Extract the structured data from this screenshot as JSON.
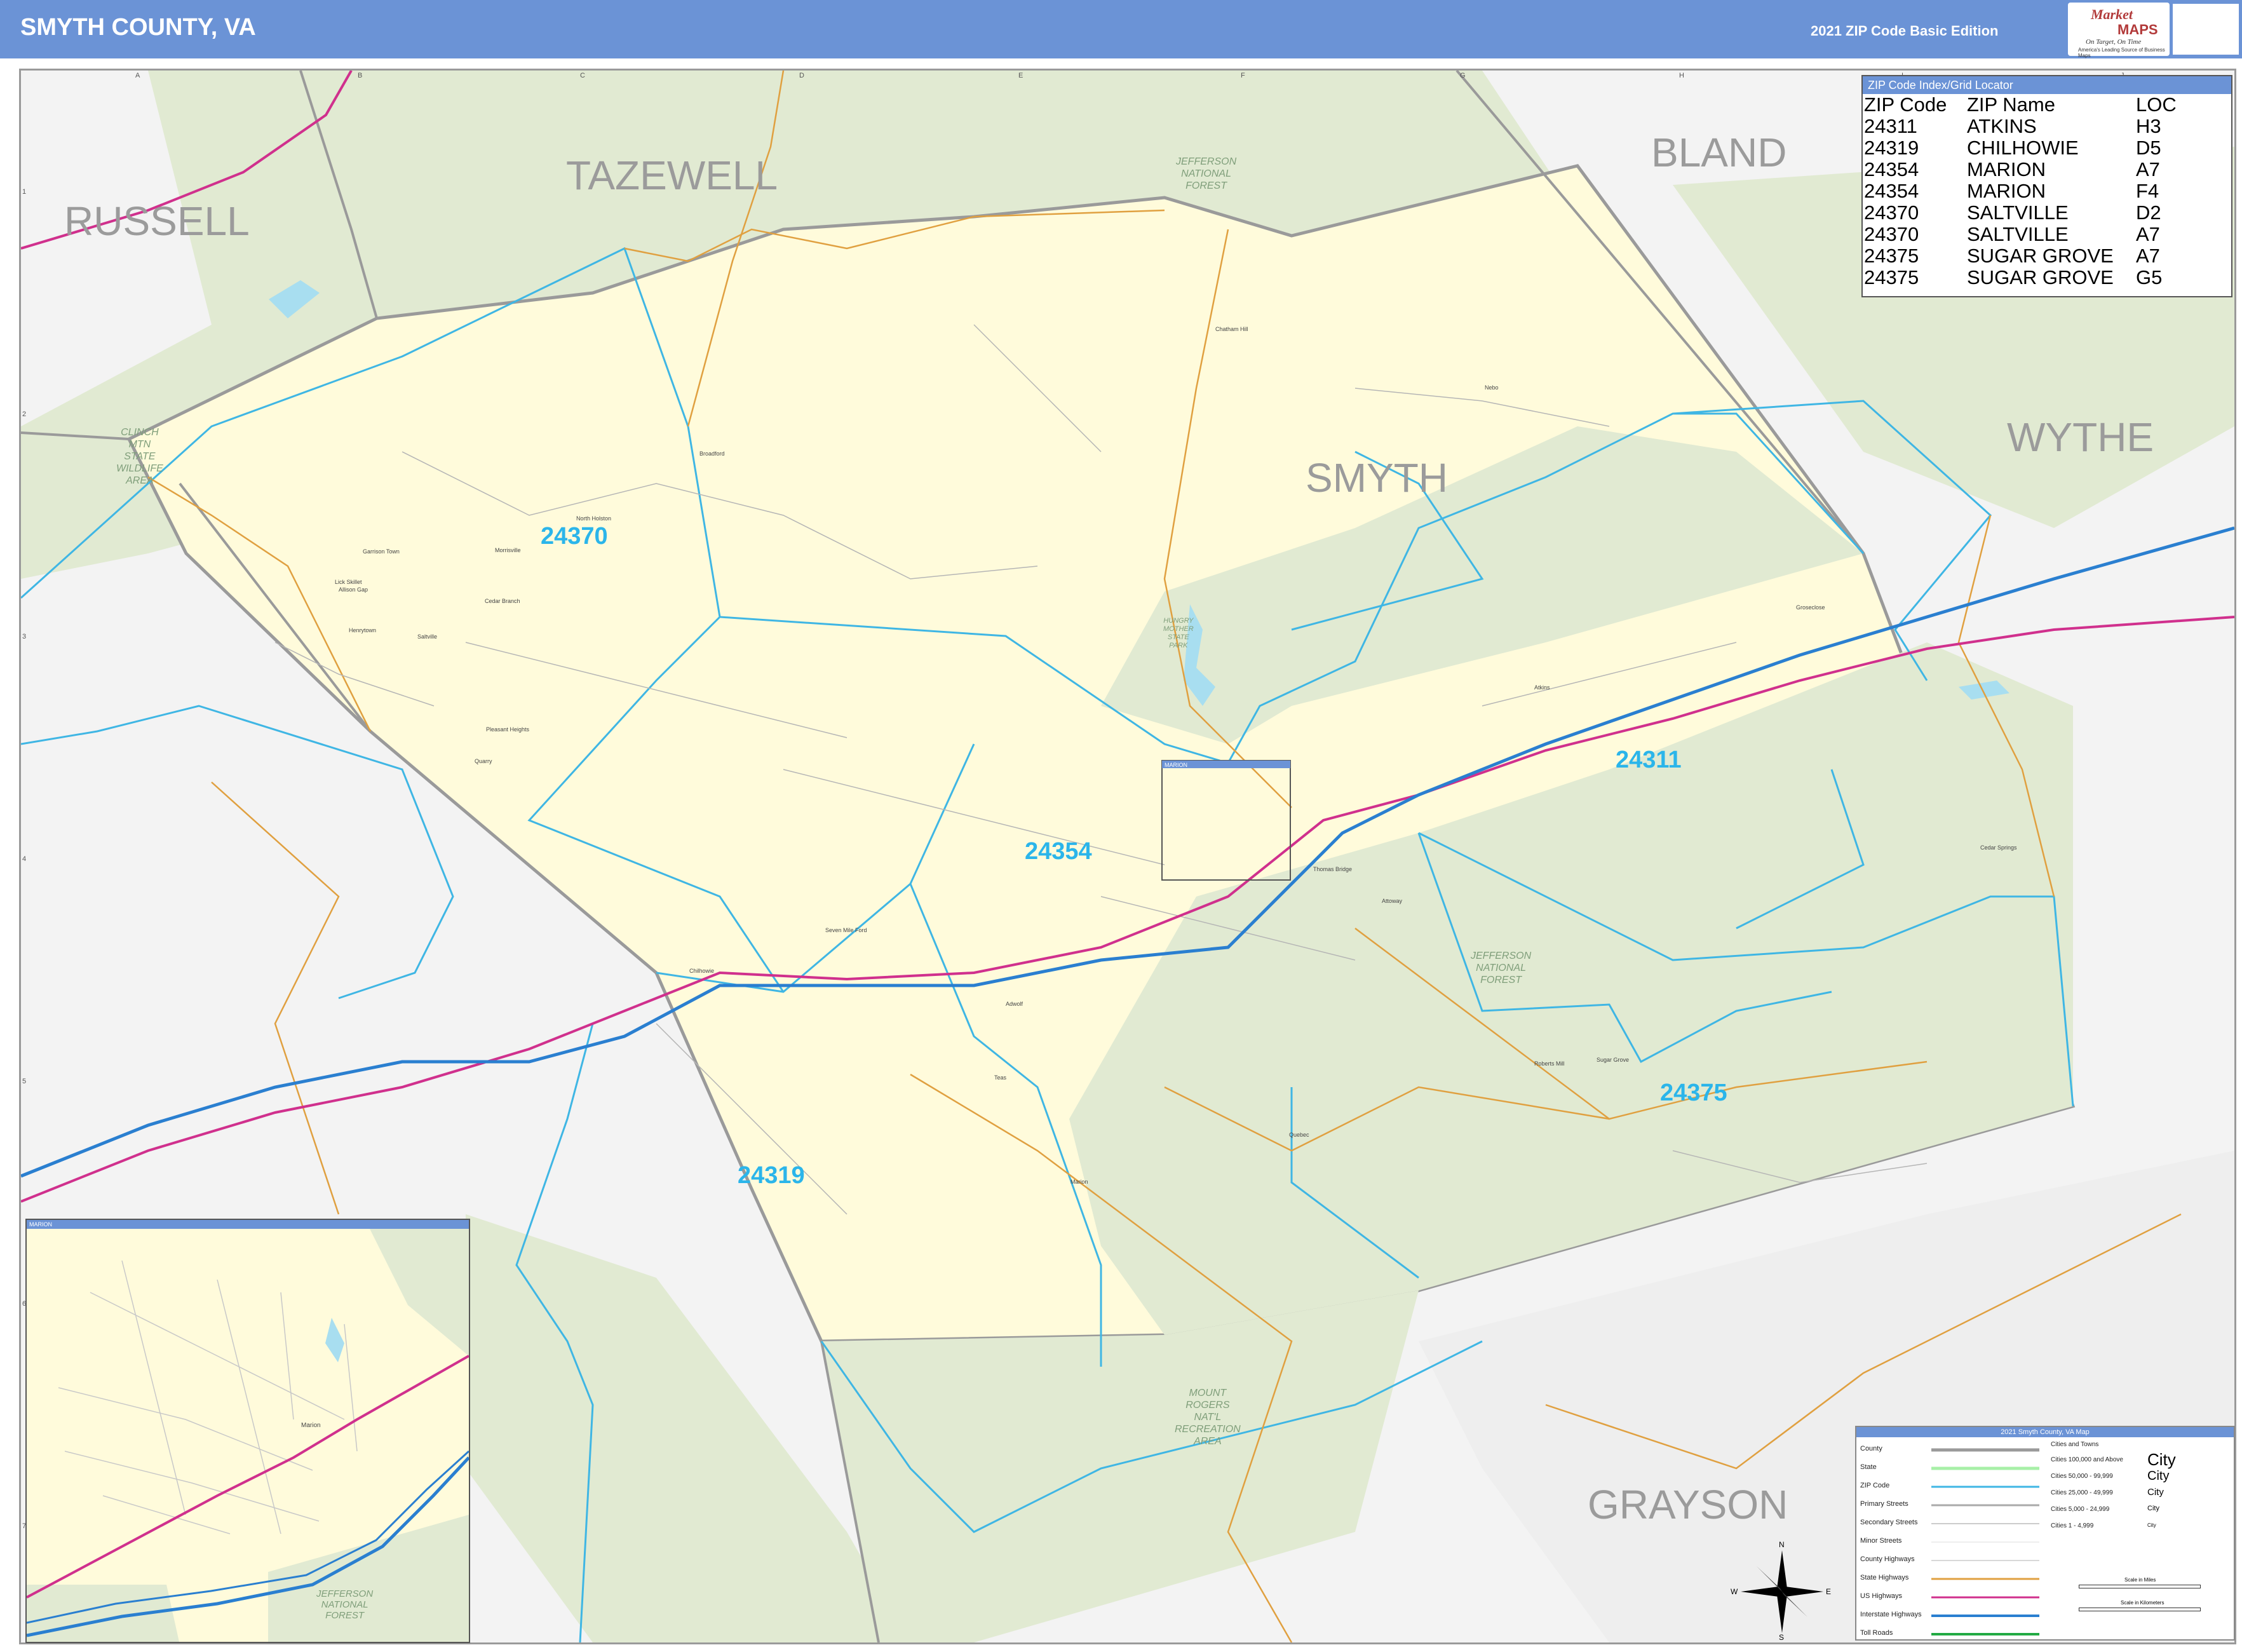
{
  "header": {
    "title": "SMYTH COUNTY, VA",
    "edition": "2021 ZIP Code Basic Edition",
    "logo_line1": "Market",
    "logo_line2": "MAPS",
    "logo_tagline": "On Target, On Time",
    "logo_sub": "America's Leading Source of Business Maps"
  },
  "grid": {
    "columns": [
      "A",
      "B",
      "C",
      "D",
      "E",
      "F",
      "G",
      "H",
      "I",
      "J"
    ],
    "rows": [
      "1",
      "2",
      "3",
      "4",
      "5",
      "6",
      "7"
    ]
  },
  "counties": {
    "russell": "RUSSELL",
    "tazewell": "TAZEWELL",
    "bland": "BLAND",
    "wythe": "WYTHE",
    "smyth": "SMYTH",
    "grayson": "GRAYSON"
  },
  "zips": {
    "z24370": "24370",
    "z24354": "24354",
    "z24311": "24311",
    "z24375": "24375",
    "z24319": "24319"
  },
  "parks": {
    "jnf_north": "JEFFERSON\nNATIONAL\nFOREST",
    "clinch": "CLINCH\nMTN\nSTATE\nWILDLIFE\nAREA",
    "hungry": "HUNGRY\nMOTHER\nSTATE\nPARK",
    "jnf_central": "JEFFERSON\nNATIONAL\nFOREST",
    "mount_rogers": "MOUNT\nROGERS\nNAT'L\nRECREATION\nAREA",
    "jnf_inset": "JEFFERSON\nNATIONAL\nFOREST"
  },
  "towns": {
    "chatham_hill": "Chatham Hill",
    "nebo": "Nebo",
    "broadford": "Broadford",
    "north_holston": "North Holston",
    "morrisville": "Morrisville",
    "garrison_town": "Garrison Town",
    "lick_skillet": "Lick Skillet",
    "allison_gap": "Allison Gap",
    "cedar_branch": "Cedar Branch",
    "henrytown": "Henrytown",
    "saltville": "Saltville",
    "pleasant_heights": "Pleasant Heights",
    "quarry": "Quarry",
    "groseclose": "Groseclose",
    "atkins": "Atkins",
    "seven_mile_ford": "Seven Mile Ford",
    "chilhowie": "Chilhowie",
    "adwolf": "Adwolf",
    "thomas_bridge": "Thomas Bridge",
    "attoway": "Attoway",
    "cedar_springs": "Cedar Springs",
    "roberts_mill": "Roberts Mill",
    "sugar_grove": "Sugar Grove",
    "quebec": "Quebec",
    "teas": "Teas",
    "marion": "Marion",
    "inset_marion": "Marion"
  },
  "zip_index": {
    "title": "ZIP Code Index/Grid Locator",
    "headers": [
      "ZIP Code",
      "ZIP Name",
      "LOC"
    ],
    "rows": [
      [
        "24311",
        "ATKINS",
        "H3"
      ],
      [
        "24319",
        "CHILHOWIE",
        "D5"
      ],
      [
        "24354",
        "MARION",
        "A7"
      ],
      [
        "24354",
        "MARION",
        "F4"
      ],
      [
        "24370",
        "SALTVILLE",
        "D2"
      ],
      [
        "24370",
        "SALTVILLE",
        "A7"
      ],
      [
        "24375",
        "SUGAR GROVE",
        "A7"
      ],
      [
        "24375",
        "SUGAR GROVE",
        "G5"
      ]
    ]
  },
  "inset": {
    "title": "MARION"
  },
  "marion_box_title": "MARION",
  "legend": {
    "title": "2021 Smyth County, VA Map",
    "rows": [
      "County",
      "State",
      "ZIP Code",
      "Primary Streets",
      "Secondary Streets",
      "Minor Streets",
      "County Highways",
      "State Highways",
      "US Highways",
      "Interstate Highways",
      "Toll Roads"
    ],
    "cities_header": "Cities and Towns",
    "city_sizes": [
      "Cities 100,000 and Above",
      "Cities 50,000 - 99,999",
      "Cities 25,000 - 49,999",
      "Cities 5,000 - 24,999",
      "Cities 1 - 4,999"
    ],
    "city_glyphs": [
      "City",
      "City",
      "City",
      "City",
      "City"
    ],
    "scale_miles": "Scale in Miles",
    "scale_km": "Scale in Kilometers"
  },
  "compass": {
    "n": "N",
    "s": "S",
    "e": "E",
    "w": "W"
  },
  "colors": {
    "header": "#6b93d6",
    "zip_label": "#2bb5ea",
    "zip_boundary": "#3fb6e4",
    "county_fill": "#fffbdb",
    "forest": "#e1ead2",
    "interstate": "#2a7fd0",
    "us_highway": "#d0308d",
    "state_highway": "#e0a040"
  }
}
